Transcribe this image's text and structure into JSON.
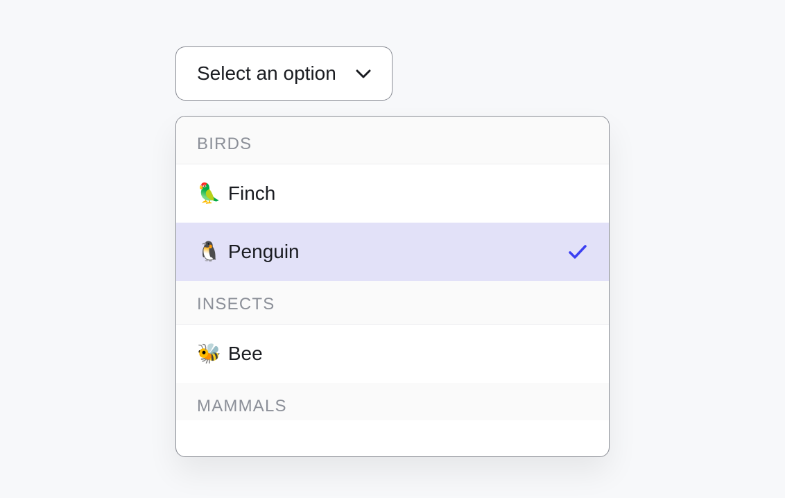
{
  "select": {
    "placeholder": "Select an option"
  },
  "groups": [
    {
      "label": "BIRDS",
      "options": [
        {
          "emoji": "🦜",
          "label": "Finch",
          "selected": false
        },
        {
          "emoji": "🐧",
          "label": "Penguin",
          "selected": true
        }
      ]
    },
    {
      "label": "INSECTS",
      "options": [
        {
          "emoji": "🐝",
          "label": "Bee",
          "selected": false
        }
      ]
    },
    {
      "label": "MAMMALS",
      "options": []
    }
  ]
}
